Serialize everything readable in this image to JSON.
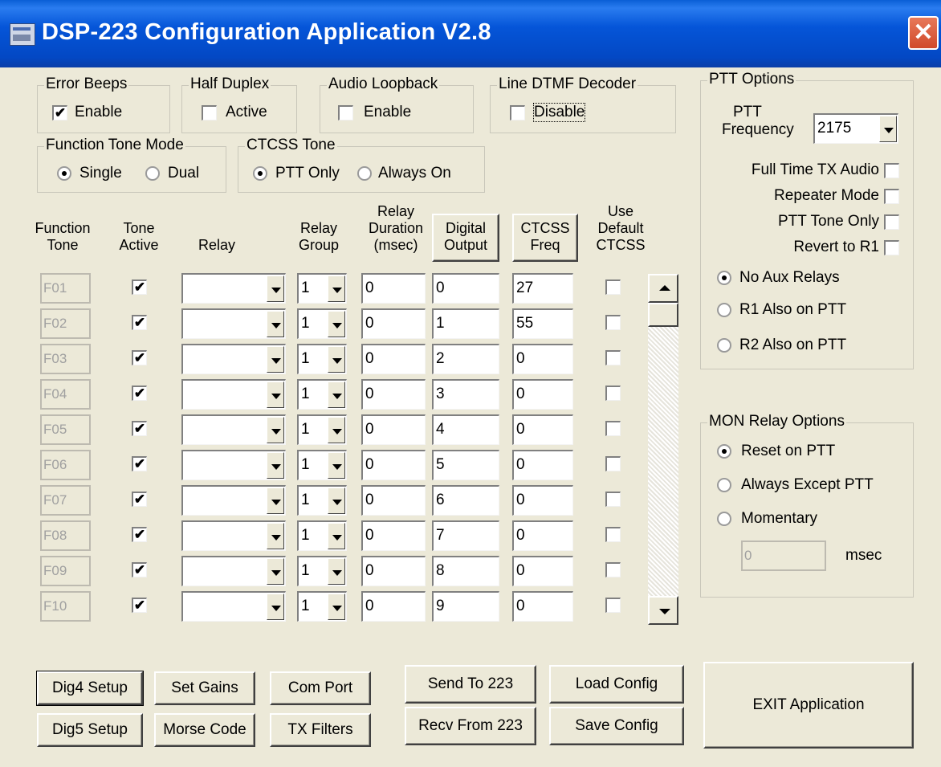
{
  "window": {
    "title": "DSP-223 Configuration Application V2.8",
    "close_glyph": "✕"
  },
  "error_beeps": {
    "title": "Error Beeps",
    "label": "Enable",
    "checked": true
  },
  "half_duplex": {
    "title": "Half Duplex",
    "label": "Active",
    "checked": false
  },
  "audio_loopback": {
    "title": "Audio Loopback",
    "label": "Enable",
    "checked": false
  },
  "line_dtmf": {
    "title": "Line DTMF Decoder",
    "label": "Disable",
    "checked": false
  },
  "function_tone_mode": {
    "title": "Function Tone Mode",
    "options": [
      "Single",
      "Dual"
    ],
    "selected": "Single"
  },
  "ctcss_tone": {
    "title": "CTCSS Tone",
    "options": [
      "PTT Only",
      "Always On"
    ],
    "selected": "PTT Only"
  },
  "table": {
    "headers": {
      "function_tone": [
        "Function",
        "Tone"
      ],
      "tone_active": [
        "Tone",
        "Active"
      ],
      "relay": "Relay",
      "relay_group": [
        "Relay",
        "Group"
      ],
      "relay_duration": [
        "Relay",
        "Duration",
        "(msec)"
      ],
      "digital_output": [
        "Digital",
        "Output"
      ],
      "ctcss_freq": [
        "CTCSS",
        "Freq"
      ],
      "use_default_ctcss": [
        "Use",
        "Default",
        "CTCSS"
      ]
    },
    "rows": [
      {
        "tone": "F01",
        "active": true,
        "relay": "",
        "group": "1",
        "duration": "0",
        "digital": "0",
        "ctcss": "27",
        "use_default": false
      },
      {
        "tone": "F02",
        "active": true,
        "relay": "",
        "group": "1",
        "duration": "0",
        "digital": "1",
        "ctcss": "55",
        "use_default": false
      },
      {
        "tone": "F03",
        "active": true,
        "relay": "",
        "group": "1",
        "duration": "0",
        "digital": "2",
        "ctcss": "0",
        "use_default": false
      },
      {
        "tone": "F04",
        "active": true,
        "relay": "",
        "group": "1",
        "duration": "0",
        "digital": "3",
        "ctcss": "0",
        "use_default": false
      },
      {
        "tone": "F05",
        "active": true,
        "relay": "",
        "group": "1",
        "duration": "0",
        "digital": "4",
        "ctcss": "0",
        "use_default": false
      },
      {
        "tone": "F06",
        "active": true,
        "relay": "",
        "group": "1",
        "duration": "0",
        "digital": "5",
        "ctcss": "0",
        "use_default": false
      },
      {
        "tone": "F07",
        "active": true,
        "relay": "",
        "group": "1",
        "duration": "0",
        "digital": "6",
        "ctcss": "0",
        "use_default": false
      },
      {
        "tone": "F08",
        "active": true,
        "relay": "",
        "group": "1",
        "duration": "0",
        "digital": "7",
        "ctcss": "0",
        "use_default": false
      },
      {
        "tone": "F09",
        "active": true,
        "relay": "",
        "group": "1",
        "duration": "0",
        "digital": "8",
        "ctcss": "0",
        "use_default": false
      },
      {
        "tone": "F10",
        "active": true,
        "relay": "",
        "group": "1",
        "duration": "0",
        "digital": "9",
        "ctcss": "0",
        "use_default": false
      }
    ]
  },
  "ptt_options": {
    "title": "PTT Options",
    "frequency_label": [
      "PTT",
      "Frequency"
    ],
    "frequency_value": "2175",
    "checks": [
      {
        "label": "Full Time TX Audio",
        "checked": false
      },
      {
        "label": "Repeater Mode",
        "checked": false
      },
      {
        "label": "PTT Tone Only",
        "checked": false
      },
      {
        "label": "Revert to R1",
        "checked": false
      }
    ],
    "radios": [
      "No Aux Relays",
      "R1 Also on PTT",
      "R2 Also on PTT"
    ],
    "selected": "No Aux Relays"
  },
  "mon_relay": {
    "title": "MON Relay Options",
    "radios": [
      "Reset on PTT",
      "Always Except PTT",
      "Momentary"
    ],
    "selected": "Reset on PTT",
    "msec_value": "0",
    "msec_label": "msec"
  },
  "buttons": {
    "dig4_setup": "Dig4 Setup",
    "set_gains": "Set Gains",
    "com_port": "Com Port",
    "send_to_223": "Send To 223",
    "load_config": "Load Config",
    "dig5_setup": "Dig5 Setup",
    "morse_code": "Morse Code",
    "tx_filters": "TX Filters",
    "recv_from_223": "Recv From 223",
    "save_config": "Save Config",
    "exit_application": "EXIT Application"
  },
  "colors": {
    "titlebar": "#0555d8",
    "window_bg": "#ece9d8",
    "close": "#d0492a"
  },
  "check_glyph": "✔"
}
